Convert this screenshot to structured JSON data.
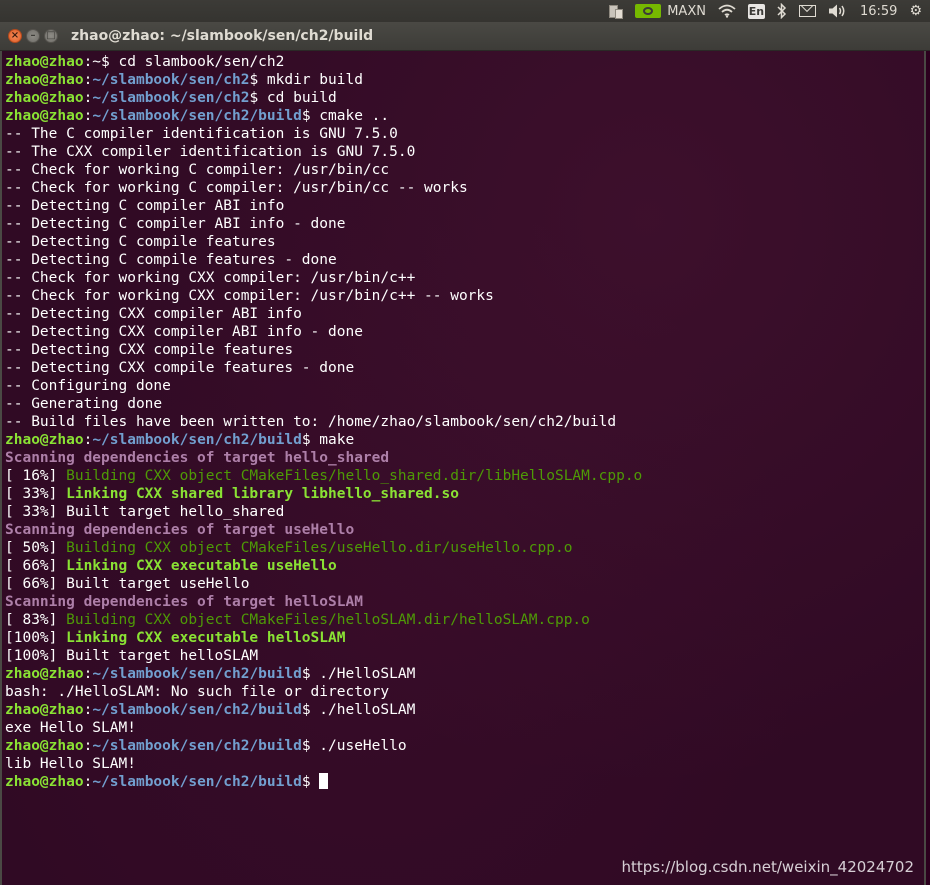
{
  "topbar": {
    "gpu_label": "MAXN",
    "keyboard_layout": "En",
    "time": "16:59"
  },
  "window": {
    "title": "zhao@zhao: ~/slambook/sen/ch2/build"
  },
  "terminal": {
    "lines": [
      [
        [
          "user",
          "zhao@zhao"
        ],
        [
          "white",
          ":~$ cd slambook/sen/ch2"
        ]
      ],
      [
        [
          "user",
          "zhao@zhao"
        ],
        [
          "white",
          ":"
        ],
        [
          "path",
          "~/slambook/sen/ch2"
        ],
        [
          "white",
          "$ mkdir build"
        ]
      ],
      [
        [
          "user",
          "zhao@zhao"
        ],
        [
          "white",
          ":"
        ],
        [
          "path",
          "~/slambook/sen/ch2"
        ],
        [
          "white",
          "$ cd build"
        ]
      ],
      [
        [
          "user",
          "zhao@zhao"
        ],
        [
          "white",
          ":"
        ],
        [
          "path",
          "~/slambook/sen/ch2/build"
        ],
        [
          "white",
          "$ cmake .."
        ]
      ],
      [
        [
          "white",
          "-- The C compiler identification is GNU 7.5.0"
        ]
      ],
      [
        [
          "white",
          "-- The CXX compiler identification is GNU 7.5.0"
        ]
      ],
      [
        [
          "white",
          "-- Check for working C compiler: /usr/bin/cc"
        ]
      ],
      [
        [
          "white",
          "-- Check for working C compiler: /usr/bin/cc -- works"
        ]
      ],
      [
        [
          "white",
          "-- Detecting C compiler ABI info"
        ]
      ],
      [
        [
          "white",
          "-- Detecting C compiler ABI info - done"
        ]
      ],
      [
        [
          "white",
          "-- Detecting C compile features"
        ]
      ],
      [
        [
          "white",
          "-- Detecting C compile features - done"
        ]
      ],
      [
        [
          "white",
          "-- Check for working CXX compiler: /usr/bin/c++"
        ]
      ],
      [
        [
          "white",
          "-- Check for working CXX compiler: /usr/bin/c++ -- works"
        ]
      ],
      [
        [
          "white",
          "-- Detecting CXX compiler ABI info"
        ]
      ],
      [
        [
          "white",
          "-- Detecting CXX compiler ABI info - done"
        ]
      ],
      [
        [
          "white",
          "-- Detecting CXX compile features"
        ]
      ],
      [
        [
          "white",
          "-- Detecting CXX compile features - done"
        ]
      ],
      [
        [
          "white",
          "-- Configuring done"
        ]
      ],
      [
        [
          "white",
          "-- Generating done"
        ]
      ],
      [
        [
          "white",
          "-- Build files have been written to: /home/zhao/slambook/sen/ch2/build"
        ]
      ],
      [
        [
          "user",
          "zhao@zhao"
        ],
        [
          "white",
          ":"
        ],
        [
          "path",
          "~/slambook/sen/ch2/build"
        ],
        [
          "white",
          "$ make"
        ]
      ],
      [
        [
          "scan",
          "Scanning dependencies of target hello_shared"
        ]
      ],
      [
        [
          "white",
          "[ 16%] "
        ],
        [
          "build",
          "Building CXX object CMakeFiles/hello_shared.dir/libHelloSLAM.cpp.o"
        ]
      ],
      [
        [
          "white",
          "[ 33%] "
        ],
        [
          "link",
          "Linking CXX shared library libhello_shared.so"
        ]
      ],
      [
        [
          "white",
          "[ 33%] Built target hello_shared"
        ]
      ],
      [
        [
          "scan",
          "Scanning dependencies of target useHello"
        ]
      ],
      [
        [
          "white",
          "[ 50%] "
        ],
        [
          "build",
          "Building CXX object CMakeFiles/useHello.dir/useHello.cpp.o"
        ]
      ],
      [
        [
          "white",
          "[ 66%] "
        ],
        [
          "link",
          "Linking CXX executable useHello"
        ]
      ],
      [
        [
          "white",
          "[ 66%] Built target useHello"
        ]
      ],
      [
        [
          "scan",
          "Scanning dependencies of target helloSLAM"
        ]
      ],
      [
        [
          "white",
          "[ 83%] "
        ],
        [
          "build",
          "Building CXX object CMakeFiles/helloSLAM.dir/helloSLAM.cpp.o"
        ]
      ],
      [
        [
          "white",
          "[100%] "
        ],
        [
          "link",
          "Linking CXX executable helloSLAM"
        ]
      ],
      [
        [
          "white",
          "[100%] Built target helloSLAM"
        ]
      ],
      [
        [
          "user",
          "zhao@zhao"
        ],
        [
          "white",
          ":"
        ],
        [
          "path",
          "~/slambook/sen/ch2/build"
        ],
        [
          "white",
          "$ ./HelloSLAM"
        ]
      ],
      [
        [
          "white",
          "bash: ./HelloSLAM: No such file or directory"
        ]
      ],
      [
        [
          "user",
          "zhao@zhao"
        ],
        [
          "white",
          ":"
        ],
        [
          "path",
          "~/slambook/sen/ch2/build"
        ],
        [
          "white",
          "$ ./helloSLAM"
        ]
      ],
      [
        [
          "white",
          "exe Hello SLAM!"
        ]
      ],
      [
        [
          "user",
          "zhao@zhao"
        ],
        [
          "white",
          ":"
        ],
        [
          "path",
          "~/slambook/sen/ch2/build"
        ],
        [
          "white",
          "$ ./useHello"
        ]
      ],
      [
        [
          "white",
          "lib Hello SLAM!"
        ]
      ],
      [
        [
          "user",
          "zhao@zhao"
        ],
        [
          "white",
          ":"
        ],
        [
          "path",
          "~/slambook/sen/ch2/build"
        ],
        [
          "white",
          "$ "
        ],
        [
          "cursor",
          ""
        ]
      ]
    ]
  },
  "watermark": "https://blog.csdn.net/weixin_42024702",
  "colors": {
    "terminal_bg": "#300a24",
    "prompt_user": "#8ae234",
    "prompt_path": "#729fcf",
    "scanning": "#ad7fa8",
    "building": "#4e9a06",
    "linking": "#8ae234"
  }
}
